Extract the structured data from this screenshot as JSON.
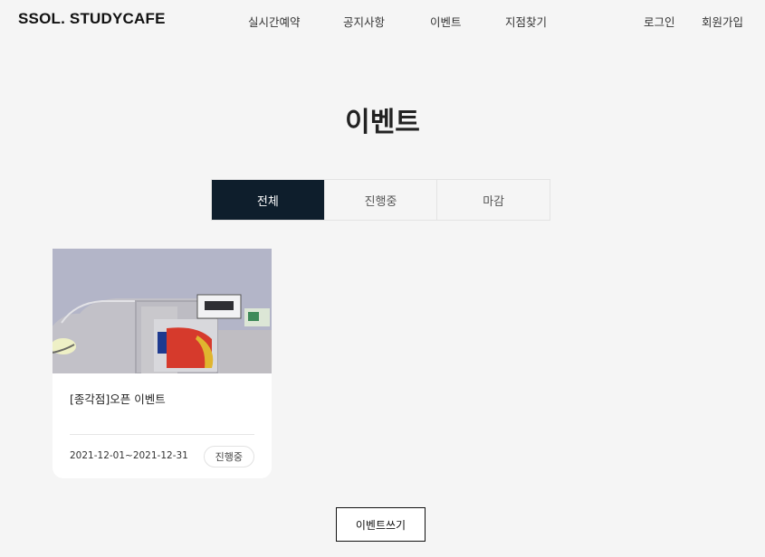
{
  "header": {
    "logo": "SSOL. STUDYCAFE",
    "nav": [
      "실시간예약",
      "공지사항",
      "이벤트",
      "지점찾기"
    ],
    "auth": [
      "로그인",
      "회원가입"
    ]
  },
  "page_title": "이벤트",
  "tabs": [
    {
      "label": "전체",
      "active": true
    },
    {
      "label": "진행중",
      "active": false
    },
    {
      "label": "마감",
      "active": false
    }
  ],
  "events": [
    {
      "title": "[종각점]오픈 이벤트",
      "date_range": "2021-12-01~2021-12-31",
      "status": "진행중"
    }
  ],
  "write_button": "이벤트쓰기",
  "colors": {
    "background": "#f5f5f5",
    "active_tab": "#0e1e2c",
    "card": "#ffffff"
  }
}
